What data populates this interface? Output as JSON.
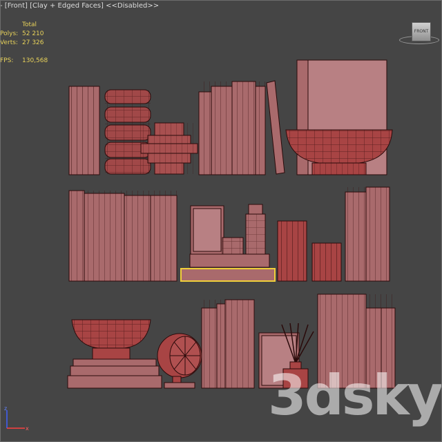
{
  "viewport": {
    "menu_label": "-",
    "view_label": "[Front]",
    "shading_label": "[Clay + Edged Faces]",
    "extra_label": "<<Disabled>>"
  },
  "stats": {
    "header": "Total",
    "polys_label": "Polys:",
    "polys_value": "52 210",
    "verts_label": "Verts:",
    "verts_value": "27 326",
    "fps_label": "FPS:",
    "fps_value": "130,568"
  },
  "viewcube": {
    "face_label": "FRONT"
  },
  "watermark": "3dsky",
  "colors": {
    "clay": "#a86668",
    "edge": "#2a0a0a",
    "selection": "#f0d03a",
    "stats_text": "#e8d25a"
  }
}
